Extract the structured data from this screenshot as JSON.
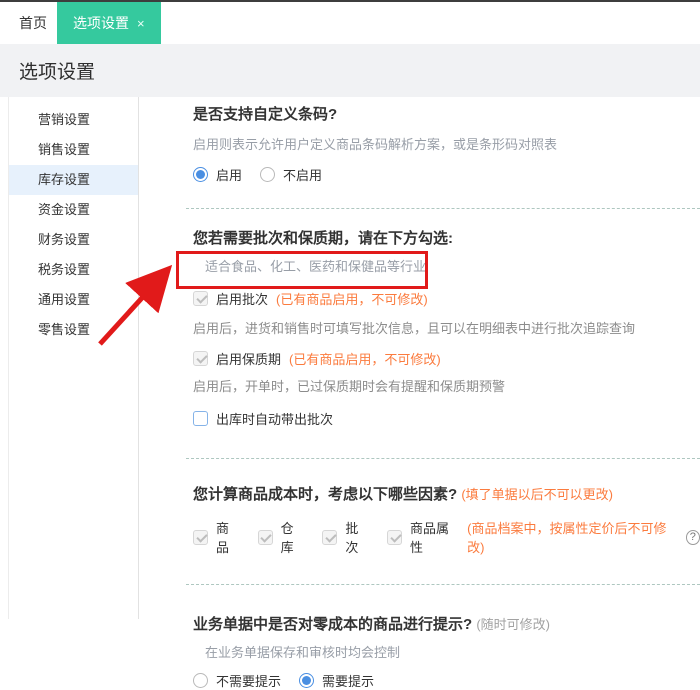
{
  "colors": {
    "accent_green": "#35c99e",
    "annotation_red": "#e11a1a",
    "warning_orange": "#fb7b3e",
    "radio_blue": "#4a8fe2",
    "active_item_bg": "#e7f1fc"
  },
  "tab_bar": {
    "home_tab": "首页",
    "active_tab": "选项设置",
    "close_icon": "×"
  },
  "page_title": "选项设置",
  "sidebar": {
    "items": [
      {
        "label": "营销设置"
      },
      {
        "label": "销售设置"
      },
      {
        "label": "库存设置",
        "active": true
      },
      {
        "label": "资金设置"
      },
      {
        "label": "财务设置"
      },
      {
        "label": "税务设置"
      },
      {
        "label": "通用设置"
      },
      {
        "label": "零售设置"
      }
    ]
  },
  "content": {
    "barcode_section": {
      "heading": "是否支持自定义条码?",
      "description": "启用则表示允许用户定义商品条码解析方案，或是条形码对照表",
      "radio_enable": "启用",
      "radio_disable": "不启用"
    },
    "batch_section": {
      "heading": "您若需要批次和保质期，请在下方勾选:",
      "description": "适合食品、化工、医药和保健品等行业",
      "enable_batch_label": "启用批次",
      "enable_batch_note": "(已有商品启用，不可修改)",
      "batch_help": "启用后，进货和销售时可填写批次信息，且可以在明细表中进行批次追踪查询",
      "enable_shelf_life_label": "启用保质期",
      "enable_shelf_life_note": "(已有商品启用，不可修改)",
      "shelf_life_help": "启用后，开单时，已过保质期时会有提醒和保质期预警",
      "auto_batch_label": "出库时自动带出批次"
    },
    "cost_section": {
      "heading": "您计算商品成本时，考虑以下哪些因素?",
      "note": "(填了单据以后不可以更改)",
      "factors": [
        "商品",
        "仓库",
        "批次",
        "商品属性"
      ],
      "attribute_note": "(商品档案中，按属性定价后不可修改)",
      "help_icon": "?"
    },
    "zero_cost_section": {
      "heading": "业务单据中是否对零成本的商品进行提示?",
      "note": "(随时可修改)",
      "description": "在业务单据保存和审核时均会控制",
      "radio_no": "不需要提示",
      "radio_yes": "需要提示"
    }
  }
}
